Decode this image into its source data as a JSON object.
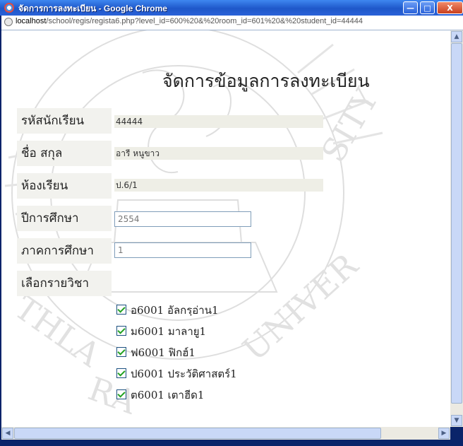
{
  "window": {
    "title": "จัดการการลงทะเบียน - Google Chrome",
    "buttons": {
      "minimize": "—",
      "maximize": "□",
      "close": "X"
    }
  },
  "address_bar": {
    "host": "localhost",
    "path": "/school/regis/regista6.php?level_id=600%20&%20room_id=601%20&%20student_id=44444"
  },
  "page": {
    "title": "จัดการข้อมูลการลงทะเบียน",
    "fields": {
      "student_id": {
        "label": "รหัสนักเรียน",
        "value": "44444"
      },
      "name": {
        "label": "ชื่อ สกุล",
        "value": "อารี หนูขาว"
      },
      "classroom": {
        "label": "ห้องเรียน",
        "value": "ป.6/1"
      },
      "academic_year": {
        "label": "ปีการศึกษา",
        "value": "2554"
      },
      "semester": {
        "label": "ภาคการศึกษา",
        "value": "1"
      },
      "subjects_label": "เลือกรายวิชา"
    },
    "subjects": [
      {
        "label": "อ6001 อัลกรฺอ่าน1",
        "checked": true
      },
      {
        "label": "ม6001 มาลายู1",
        "checked": true
      },
      {
        "label": "ฟ6001 ฟิกฮ์1",
        "checked": true
      },
      {
        "label": "ป6001 ประวัติศาสตร์1",
        "checked": true
      },
      {
        "label": "ต6001 เตาฮีด1",
        "checked": true
      }
    ],
    "watermark_text": "UNIVERSITY"
  }
}
